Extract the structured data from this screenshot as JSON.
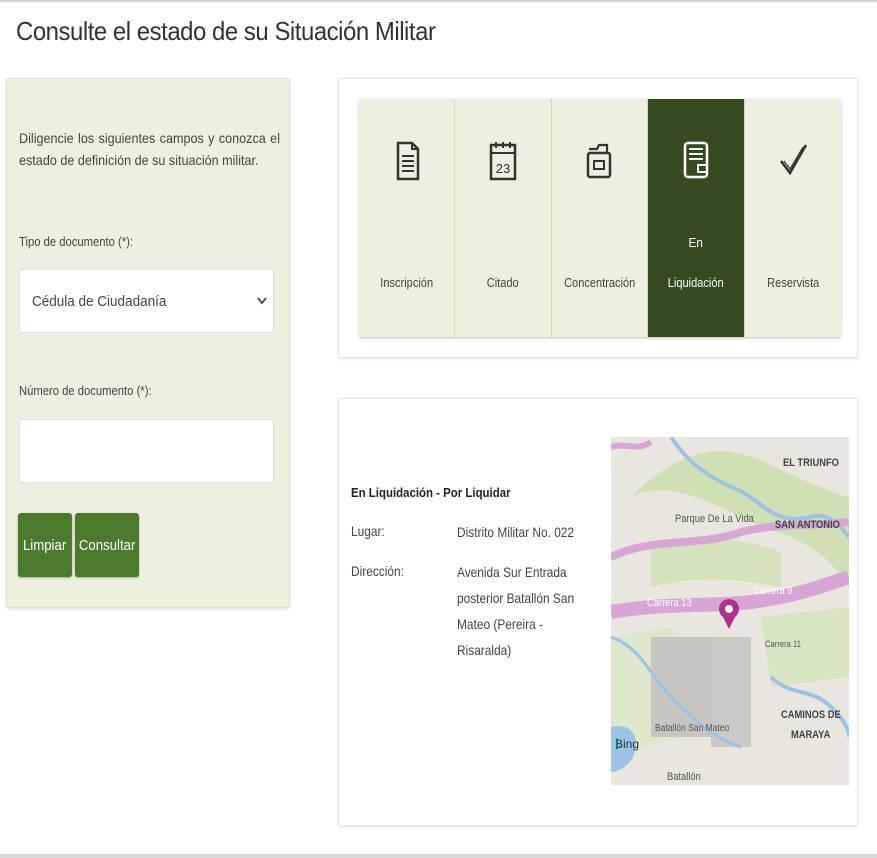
{
  "page": {
    "title": "Consulte el estado de su Situación Militar"
  },
  "form": {
    "intro": "Diligencie los siguientes campos y conozca el estado de definición de su situación militar.",
    "doc_type_label": "Tipo de documento (*):",
    "doc_type_value": "Cédula de Ciudadanía",
    "doc_number_label": "Número de documento (*):",
    "doc_number_value": "",
    "clear_button": "Limpiar",
    "submit_button": "Consultar"
  },
  "steps": [
    {
      "label": "Inscripción",
      "prefix": "",
      "icon": "document-icon",
      "active": false
    },
    {
      "label": "Citado",
      "prefix": "",
      "icon": "calendar-icon",
      "active": false
    },
    {
      "label": "Concentración",
      "prefix": "",
      "icon": "folder-icon",
      "active": false
    },
    {
      "label": "Liquidación",
      "prefix": "En",
      "icon": "wallet-icon",
      "active": true
    },
    {
      "label": "Reservista",
      "prefix": "",
      "icon": "checkmark-icon",
      "active": false
    }
  ],
  "detail": {
    "title": "En Liquidación - Por Liquidar",
    "place_label": "Lugar:",
    "place_value": "Distrito Militar No. 022",
    "address_label": "Dirección:",
    "address_value": "Avenida Sur Entrada posterior Batallón San Mateo (Pereira - Risaralda)"
  },
  "map": {
    "labels": {
      "el_triunfo": "EL TRIUNFO",
      "parque": "Parque De La Vida",
      "san_antonio": "SAN ANTONIO",
      "carrera13": "Carrera 13",
      "carrera9": "Carrera 9",
      "carrera11": "Carrera 11",
      "caminos1": "CAMINOS DE",
      "caminos2": "MARAYA",
      "batallon_san_mateo": "Batallón San Mateo",
      "batallon": "Batallón",
      "bing": "Bing"
    }
  },
  "colors": {
    "accent_green": "#4b7a2c",
    "active_step": "#354a1e",
    "panel_bg": "#eef0df"
  }
}
